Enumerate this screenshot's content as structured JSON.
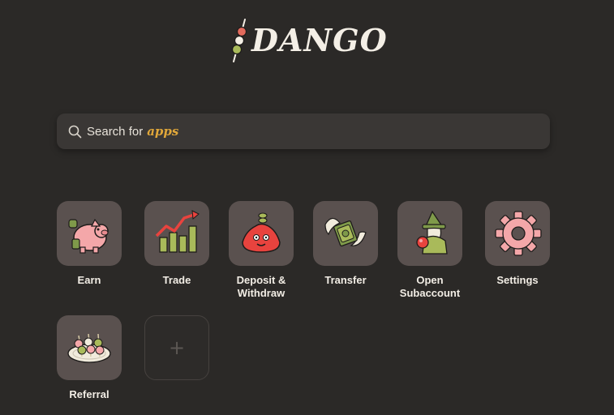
{
  "brand": {
    "name": "DANGO"
  },
  "search": {
    "prefix": "Search for",
    "accent": "apps"
  },
  "apps": [
    {
      "label": "Earn",
      "icon": "piggy-bank-icon"
    },
    {
      "label": "Trade",
      "icon": "bar-chart-arrow-icon"
    },
    {
      "label": "Deposit &\nWithdraw",
      "icon": "money-bag-icon"
    },
    {
      "label": "Transfer",
      "icon": "winged-money-icon"
    },
    {
      "label": "Open\nSubaccount",
      "icon": "wizard-icon"
    },
    {
      "label": "Settings",
      "icon": "gear-icon"
    },
    {
      "label": "Referral",
      "icon": "dango-plate-icon"
    }
  ],
  "add_app": {
    "symbol": "+"
  },
  "colors": {
    "background": "#2b2927",
    "tile": "#5a514f",
    "accent": "#e0a73a",
    "text": "#f2ede5"
  }
}
